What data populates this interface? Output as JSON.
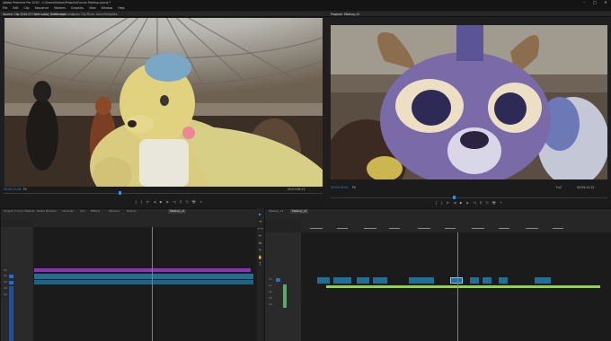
{
  "app": {
    "title": "Adobe Premiere Pro 2020 - C:\\Users\\Videos\\Projects\\Furcon Meetup.prproj *",
    "window_controls": [
      "–",
      "□",
      "✕"
    ],
    "menu": [
      "File",
      "Edit",
      "Clip",
      "Sequence",
      "Markers",
      "Graphics",
      "View",
      "Window",
      "Help"
    ]
  },
  "source_monitor": {
    "tabs": [
      "Source: Clip 2015-07 Hotel Lobby Dome.mp4",
      "Effect Controls",
      "Audio Clip Mixer: Dome",
      "Metadata"
    ],
    "timecode_in": "00:00:12:08",
    "zoom": "Fit",
    "duration": "00:01:06:21",
    "transport": [
      "{",
      "}",
      "|←",
      "◂|",
      "▶",
      "|▸",
      "→|",
      "⎘",
      "⎗",
      "📷",
      "+"
    ]
  },
  "program_monitor": {
    "tabs": [
      "Program: Meetup_v2"
    ],
    "timecode_in": "00:03:44:02",
    "zoom": "Fit",
    "quality": "Full",
    "duration": "00:09:12:15",
    "transport": [
      "{",
      "}",
      "|←",
      "◂|",
      "▶",
      "|▸",
      "→|",
      "⎘",
      "⎗",
      "📷",
      "+"
    ]
  },
  "left_timeline": {
    "tabs": [
      "Project: Furcon Meetup",
      "Media Browser",
      "Libraries",
      "Info",
      "Effects",
      "Markers",
      "History"
    ],
    "active_tab": "Meetup_v1",
    "track_labels": [
      "V3",
      "V2",
      "V1",
      "A1",
      "A2",
      "A3",
      "A4"
    ]
  },
  "right_timeline": {
    "tabs": [
      "Meetup_v1",
      "Meetup_v2"
    ],
    "track_labels": [
      "V3",
      "V2",
      "V1",
      "A1",
      "A2",
      "A3",
      "A4"
    ]
  },
  "tools": [
    "▶",
    "⇥",
    "⟷",
    "✂",
    "⇆",
    "✎",
    "✋",
    "T"
  ],
  "colors": {
    "accent_blue": "#2f8fe0",
    "video_clip_purple": "#8b34b4",
    "audio_clip_blue": "#1f6f96",
    "audio_green": "#8ed44a"
  }
}
